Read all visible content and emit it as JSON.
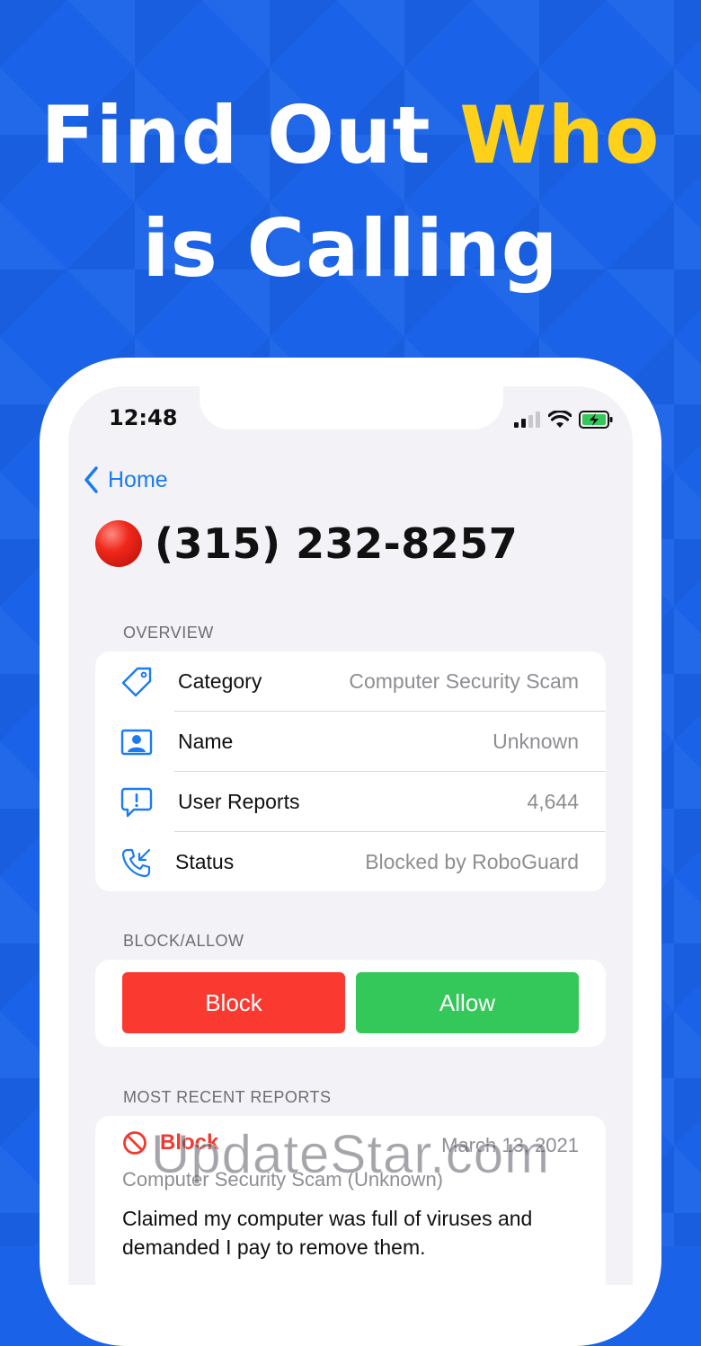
{
  "headline": {
    "line1_part1": "Find Out ",
    "line1_highlight": "Who",
    "line2": "is Calling"
  },
  "colors": {
    "background": "#1a63e8",
    "highlight": "#ffd01a",
    "accent": "#1a7cf0",
    "block": "#fa3a31",
    "allow": "#34c759"
  },
  "status_bar": {
    "time": "12:48",
    "icons": [
      "signal-icon",
      "wifi-icon",
      "battery-charging-icon"
    ]
  },
  "nav": {
    "back_label": "Home"
  },
  "page": {
    "phone_number": "(315) 232-8257",
    "status_indicator": "red-circle"
  },
  "overview": {
    "section_label": "OVERVIEW",
    "rows": [
      {
        "icon": "tag-icon",
        "label": "Category",
        "value": "Computer Security Scam"
      },
      {
        "icon": "contact-card-icon",
        "label": "Name",
        "value": "Unknown"
      },
      {
        "icon": "report-bubble-icon",
        "label": "User Reports",
        "value": "4,644"
      },
      {
        "icon": "phone-incoming-icon",
        "label": "Status",
        "value": "Blocked by RoboGuard"
      }
    ]
  },
  "block_allow": {
    "section_label": "BLOCK/ALLOW",
    "block_label": "Block",
    "allow_label": "Allow"
  },
  "recent_reports": {
    "section_label": "MOST RECENT REPORTS",
    "reports": [
      {
        "action": "Block",
        "date": "March 13, 2021",
        "subtitle": "Computer Security Scam (Unknown)",
        "text": "Claimed my computer was full of viruses and demanded I pay to remove them."
      }
    ]
  },
  "watermark": "UpdateStar.com"
}
